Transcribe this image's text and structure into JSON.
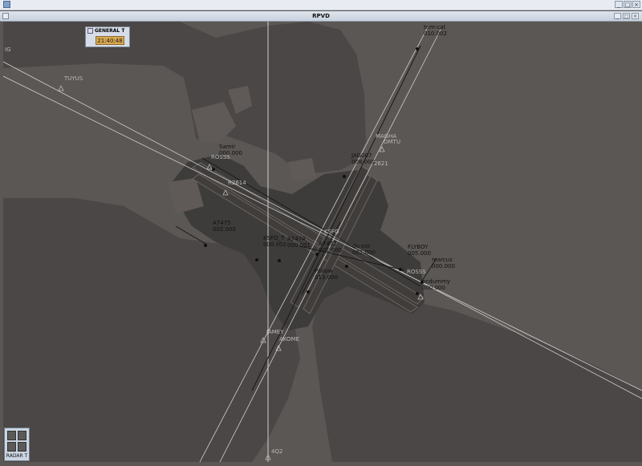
{
  "window": {
    "title": "RPVD",
    "buttons": [
      "_",
      "□",
      "×"
    ]
  },
  "clock_widget": {
    "title": "GENERAL T",
    "time": "21:40:48"
  },
  "minimized_widget": {
    "label": "RADAR T"
  },
  "fixes": [
    "IG",
    "TUYUS",
    "ROSSS",
    "R2614",
    "MAGHA",
    "OMTU",
    "2621",
    "KSFO",
    "ROSSS",
    "JAMEY",
    "AKOME",
    "4Q2"
  ],
  "tracks": [
    {
      "callsign": "tem-cat",
      "data": "010.002"
    },
    {
      "callsign": "Samir",
      "data": "000.000"
    },
    {
      "callsign": "JAG007",
      "data": "008.000"
    },
    {
      "callsign": "A7475",
      "data": "002.000"
    },
    {
      "callsign": "KSFO_T",
      "data": "000.002"
    },
    {
      "callsign": "A7474",
      "data": "000.001"
    },
    {
      "callsign": "A7472",
      "data": "007.000"
    },
    {
      "callsign": "du-cor",
      "data": "001.000"
    },
    {
      "callsign": "FLYBOY",
      "data": "005.000"
    },
    {
      "callsign": "marcus",
      "data": "000.000"
    },
    {
      "callsign": "Pinlow",
      "data": "013.000"
    },
    {
      "callsign": "ncdummy",
      "data": "000.000"
    }
  ],
  "colors": {
    "background": "#5b5754",
    "land": "#4b4746",
    "airport": "#3e3c3b",
    "runway": "#403d3b",
    "route_line": "#cfcfcf",
    "clock_bg": "#d9a84f"
  }
}
